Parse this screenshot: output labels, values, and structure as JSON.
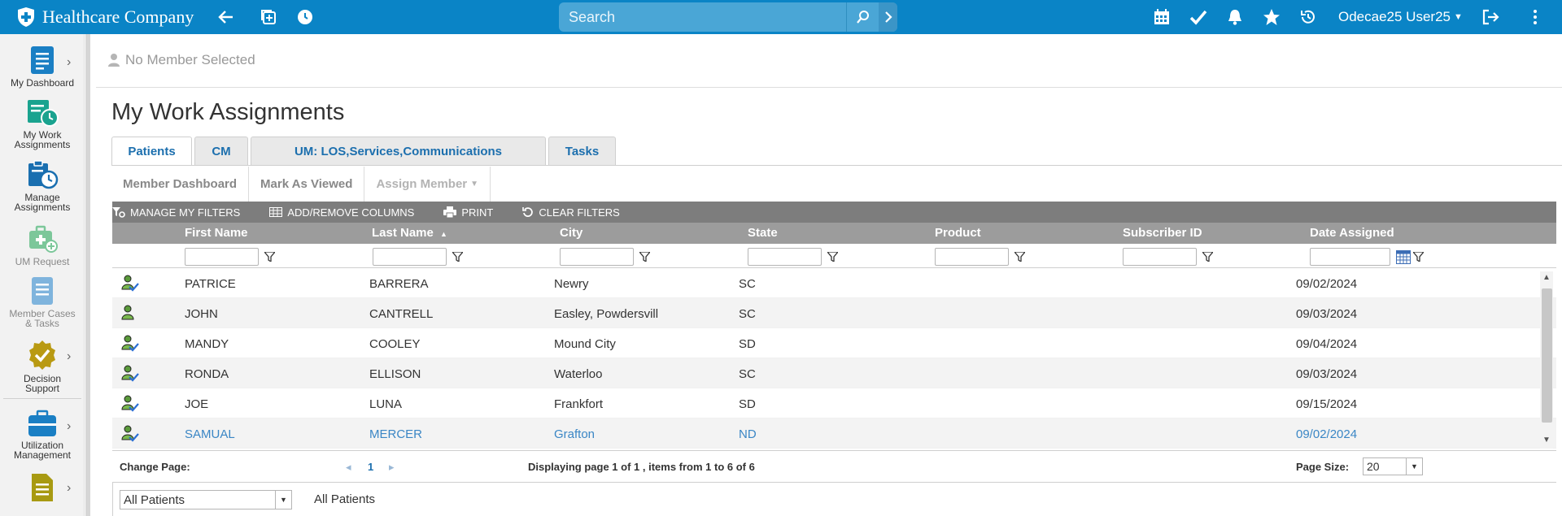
{
  "header": {
    "brand_name": "Healthcare Company",
    "search_placeholder": "Search",
    "user_name": "Odecae25 User25"
  },
  "sidebar": {
    "items": [
      {
        "label": "My Dashboard",
        "icon": "dashboard-icon"
      },
      {
        "label_line1": "My Work",
        "label_line2": "Assignments",
        "icon": "work-assignments-icon"
      },
      {
        "label_line1": "Manage",
        "label_line2": "Assignments",
        "icon": "manage-assignments-icon"
      },
      {
        "label": "UM Request",
        "icon": "um-request-icon"
      },
      {
        "label_line1": "Member Cases",
        "label_line2": "& Tasks",
        "icon": "member-cases-icon"
      },
      {
        "label_line1": "Decision",
        "label_line2": "Support",
        "icon": "decision-support-icon"
      },
      {
        "label_line1": "Utilization",
        "label_line2": "Management",
        "icon": "utilization-management-icon"
      },
      {
        "label": "",
        "icon": "document-icon"
      }
    ]
  },
  "member": {
    "text": "No Member Selected"
  },
  "page": {
    "title": "My Work Assignments"
  },
  "tabs": [
    {
      "label": "Patients"
    },
    {
      "label": "CM"
    },
    {
      "label": "UM: LOS,Services,Communications"
    },
    {
      "label": "Tasks"
    }
  ],
  "actions": {
    "member_dashboard": "Member Dashboard",
    "mark_as_viewed": "Mark As Viewed",
    "assign_member": "Assign Member"
  },
  "grid_toolbar": {
    "manage_filters": "MANAGE MY FILTERS",
    "add_remove_columns": "ADD/REMOVE COLUMNS",
    "print": "PRINT",
    "clear_filters": "CLEAR FILTERS"
  },
  "columns": {
    "first_name": "First Name",
    "last_name": "Last Name",
    "city": "City",
    "state": "State",
    "product": "Product",
    "subscriber_id": "Subscriber ID",
    "date_assigned": "Date Assigned"
  },
  "rows": [
    {
      "first": "PATRICE",
      "last": "BARRERA",
      "city": "Newry",
      "state": "SC",
      "date": "09/02/2024",
      "viewed": true
    },
    {
      "first": "JOHN",
      "last": "CANTRELL",
      "city": "Easley, Powdersvill",
      "state": "SC",
      "date": "09/03/2024",
      "viewed": false
    },
    {
      "first": "MANDY",
      "last": "COOLEY",
      "city": "Mound City",
      "state": "SD",
      "date": "09/04/2024",
      "viewed": true
    },
    {
      "first": "RONDA",
      "last": "ELLISON",
      "city": "Waterloo",
      "state": "SC",
      "date": "09/03/2024",
      "viewed": true
    },
    {
      "first": "JOE",
      "last": "LUNA",
      "city": "Frankfort",
      "state": "SD",
      "date": "09/15/2024",
      "viewed": true
    },
    {
      "first": "SAMUAL",
      "last": "MERCER",
      "city": "Grafton",
      "state": "ND",
      "date": "09/02/2024",
      "viewed": true
    }
  ],
  "pager": {
    "change_page_label": "Change Page:",
    "current_page": "1",
    "summary": "Displaying page 1 of 1 , items from 1 to 6 of 6",
    "page_size_label": "Page Size:",
    "page_size": "20"
  },
  "footer": {
    "select_value": "All Patients",
    "label": "All Patients"
  },
  "colors": {
    "topbar": "#0a84c6",
    "link": "#1c6fae",
    "header_row": "#9c9c9c",
    "toolbar": "#7d7d7d"
  }
}
